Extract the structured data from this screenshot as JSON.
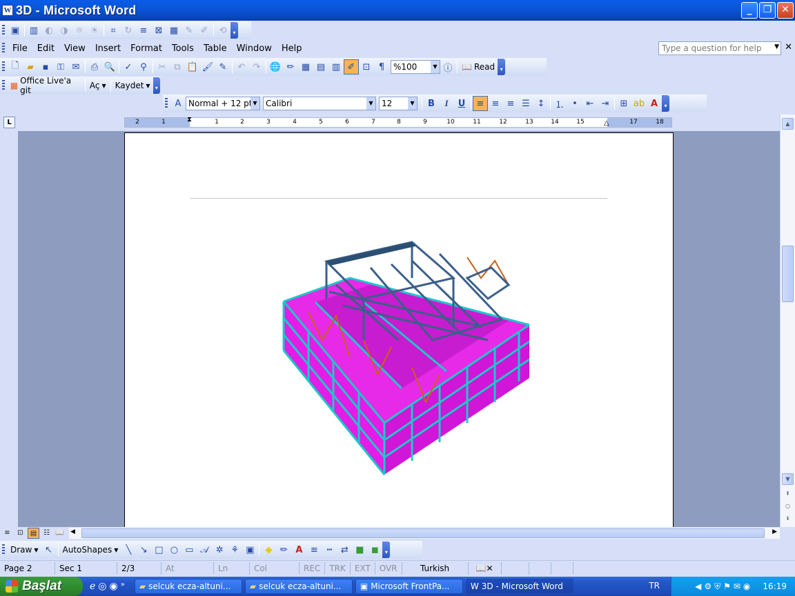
{
  "window": {
    "title": "3D - Microsoft Word",
    "app_icon": "W"
  },
  "menu": [
    "File",
    "Edit",
    "View",
    "Insert",
    "Format",
    "Tools",
    "Table",
    "Window",
    "Help"
  ],
  "help": {
    "placeholder": "Type a question for help"
  },
  "standard": {
    "zoom": "%100",
    "read_label": "Read"
  },
  "office_live": {
    "label": "Office Live'a git",
    "open": "Aç",
    "save": "Kaydet"
  },
  "formatting": {
    "style": "Normal + 12 pt",
    "font": "Calibri",
    "size": "12",
    "bold": "B",
    "italic": "I",
    "underline": "U"
  },
  "ruler": {
    "corner": "L",
    "numbers": [
      "2",
      "1",
      "1",
      "2",
      "3",
      "4",
      "5",
      "6",
      "7",
      "8",
      "9",
      "10",
      "11",
      "12",
      "13",
      "14",
      "15",
      "17",
      "18"
    ]
  },
  "drawing": {
    "draw": "Draw",
    "autoshapes": "AutoShapes"
  },
  "status": {
    "page": "Page 2",
    "sec": "Sec 1",
    "pages": "2/3",
    "at": "At",
    "ln": "Ln",
    "col": "Col",
    "rec": "REC",
    "trk": "TRK",
    "ext": "EXT",
    "ovr": "OVR",
    "language": "Turkish"
  },
  "taskbar": {
    "start": "Başlat",
    "tasks": [
      "selcuk ecza-altuni...",
      "selcuk ecza-altuni...",
      "Microsoft FrontPa...",
      "3D - Microsoft Word"
    ],
    "lang": "TR",
    "clock": "16:19"
  },
  "colors": {
    "slab": "#e41ce8",
    "column": "#1cc8c8",
    "steel": "#3a5f8a",
    "brace": "#c8601c"
  }
}
